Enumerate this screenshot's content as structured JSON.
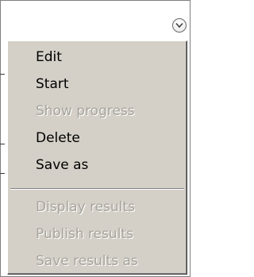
{
  "menu": {
    "items": [
      {
        "label": "Edit",
        "enabled": true
      },
      {
        "label": "Start",
        "enabled": true
      },
      {
        "label": "Show progress",
        "enabled": false
      },
      {
        "label": "Delete",
        "enabled": true
      },
      {
        "label": "Save as",
        "enabled": true
      }
    ],
    "items2": [
      {
        "label": "Display results",
        "enabled": false
      },
      {
        "label": "Publish results",
        "enabled": false
      },
      {
        "label": "Save results as",
        "enabled": false
      }
    ]
  },
  "dropdown": {
    "icon": "chevron-down-icon"
  },
  "colors": {
    "menu_bg": "#d4d0c8",
    "disabled_text": "#a8a49c",
    "enabled_text": "#000000"
  }
}
